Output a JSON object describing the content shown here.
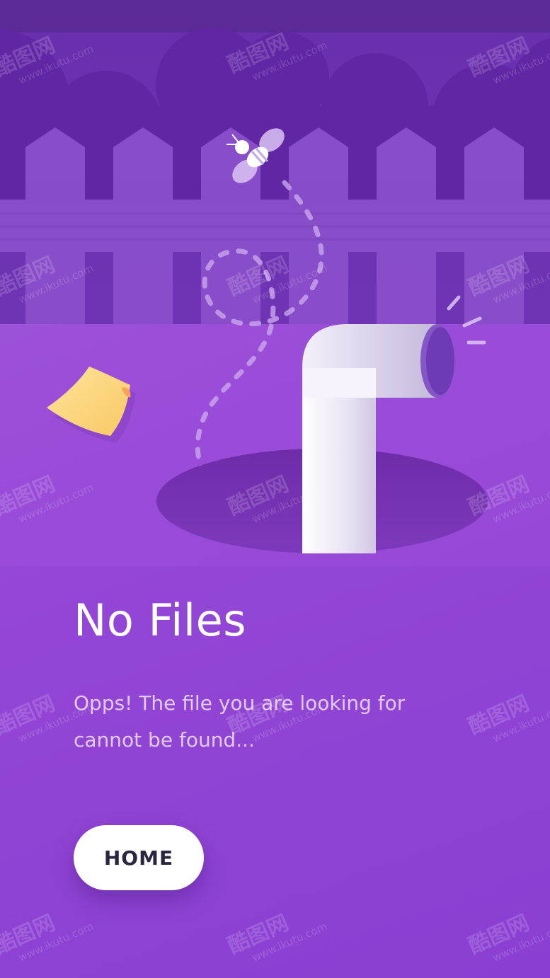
{
  "screen": {
    "title": "No Files",
    "message_line1": "Opps! The file you are looking for",
    "message_line2": "cannot be found...",
    "button_label": "HOME"
  },
  "watermark": {
    "mark": "酷图网",
    "url": "www.ikutu.com"
  },
  "illustration": {
    "icons": [
      "bee-icon",
      "sticky-note-icon",
      "periscope-pipe-icon",
      "hole-icon",
      "fence"
    ]
  },
  "colors": {
    "background_top": "#a45bdd",
    "background_bottom": "#8a3fd2",
    "sky": "#6a2fae",
    "fence": "#9157cf",
    "button_bg": "#ffffff",
    "button_text": "#2a2640",
    "note": "#ffd57e"
  }
}
